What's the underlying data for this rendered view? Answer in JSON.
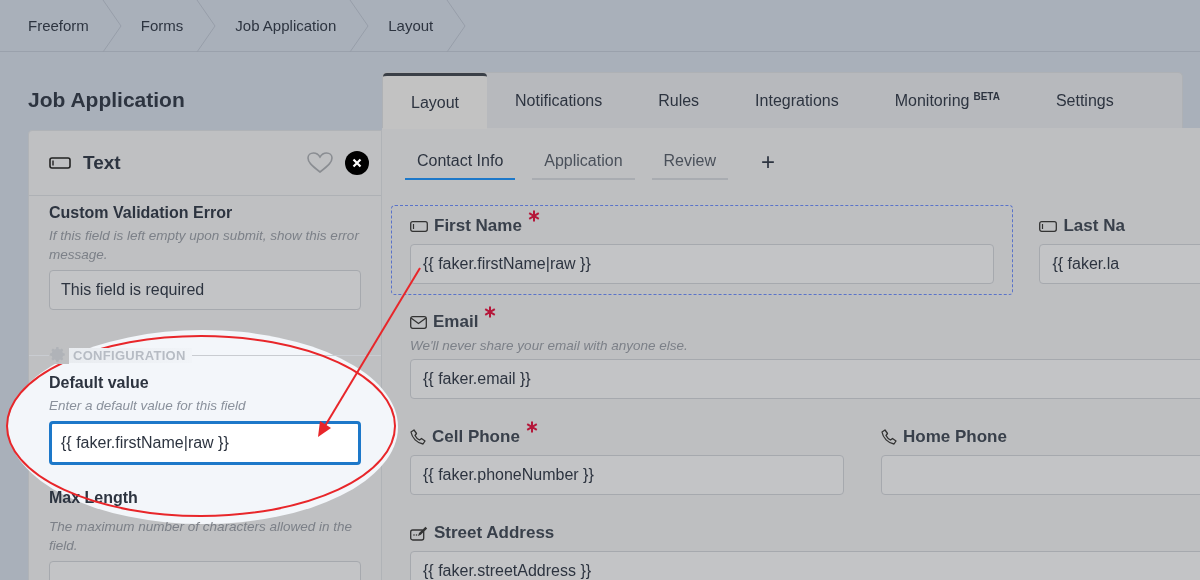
{
  "breadcrumbs": [
    "Freeform",
    "Forms",
    "Job Application",
    "Layout"
  ],
  "page_title": "Job Application",
  "field_panel": {
    "title": "Text",
    "favorite": false,
    "sections": [
      {
        "kind": "input",
        "label": "Custom Validation Error",
        "description": "If this field is left empty upon submit, show this error message.",
        "value": "This field is required",
        "focused": false,
        "highlighted": false
      },
      {
        "kind": "divider",
        "label": "CONFIGURATION"
      },
      {
        "kind": "input",
        "label": "Default value",
        "description": "Enter a default value for this field",
        "value": "{{ faker.firstName|raw }}",
        "focused": true,
        "highlighted": true
      },
      {
        "kind": "input",
        "label": "Max Length",
        "description": "The maximum number of characters allowed in the field.",
        "focused": false,
        "highlighted": false
      }
    ]
  },
  "tabs": [
    {
      "label": "Layout",
      "selected": true
    },
    {
      "label": "Notifications",
      "selected": false
    },
    {
      "label": "Rules",
      "selected": false
    },
    {
      "label": "Integrations",
      "selected": false
    },
    {
      "label": "Monitoring",
      "superscript": "BETA",
      "selected": false
    },
    {
      "label": "Settings",
      "selected": false
    }
  ],
  "pages": [
    {
      "label": "Contact Info",
      "selected": true
    },
    {
      "label": "Application",
      "selected": false
    },
    {
      "label": "Review",
      "selected": false
    }
  ],
  "add_page": "+",
  "rows": [
    [
      {
        "kind": "text",
        "label": "First Name",
        "required": true,
        "selected": true,
        "value": "{{ faker.firstName|raw }}"
      },
      {
        "kind": "text",
        "label": "Last Na",
        "required": false,
        "selected": false,
        "value": "{{ faker.la"
      }
    ],
    [
      {
        "kind": "email",
        "label": "Email",
        "required": true,
        "selected": false,
        "description": "We'll never share your email with anyone else.",
        "value": "{{ faker.email }}"
      }
    ],
    [
      {
        "kind": "phone",
        "label": "Cell Phone",
        "required": true,
        "selected": false,
        "value": "{{ faker.phoneNumber }}"
      },
      {
        "kind": "phone",
        "label": "Home Phone",
        "required": false,
        "selected": false
      }
    ],
    [
      {
        "kind": "address",
        "label": "Street Address",
        "required": false,
        "selected": false,
        "value": "{{ faker.streetAddress }}"
      }
    ]
  ]
}
